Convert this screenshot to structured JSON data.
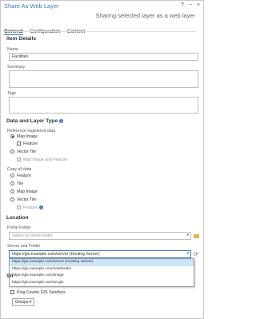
{
  "window": {
    "title": "Share As Web Layer",
    "help": "?",
    "minimize": "−",
    "close": "×",
    "subtitle": "Sharing selected layer as a web layer"
  },
  "tabs": [
    "General",
    "Configuration",
    "Content"
  ],
  "item_details": {
    "heading": "Item Details",
    "name_label": "Name",
    "name_value": "Facilities",
    "summary_label": "Summary",
    "tags_label": "Tags"
  },
  "data_layer_type": {
    "heading": "Data and Layer Type",
    "reference_label": "Reference registered data",
    "reference_options": [
      {
        "label": "Map Image",
        "checked": true
      },
      {
        "label": "Feature",
        "checked": false
      },
      {
        "label": "Vector Tile",
        "checked": false
      },
      {
        "label": "Map Image and Feature",
        "checked": true
      }
    ],
    "copy_label": "Copy all data",
    "copy_options": [
      "Feature",
      "Tile",
      "Map Image",
      "Vector Tile",
      "Feature"
    ]
  },
  "location": {
    "heading": "Location",
    "portal_folder_label": "Portal Folder",
    "portal_folder_placeholder": "Select or create folder",
    "server_label": "Server and Folder",
    "server_value": "https://gis.example.com/server (Hosting Server)",
    "dropdown_items": [
      "https://gis.example.com/server (Hosting Server)",
      "https://gis.example.com/notebooks",
      "https://gis.example.com/image",
      "https://gis.example.com/arcgis"
    ]
  },
  "sharing": {
    "heading": "Sh",
    "group_label": "King County GIS Sandbox",
    "groups_button": "Groups"
  }
}
